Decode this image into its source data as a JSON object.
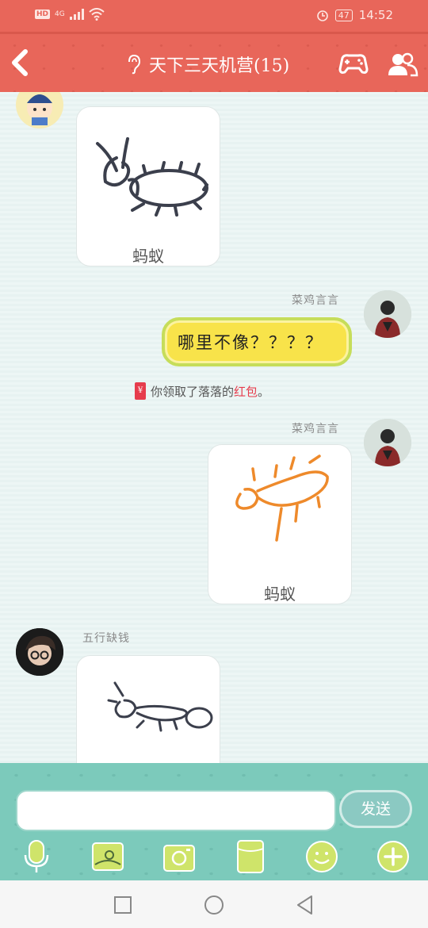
{
  "status_bar": {
    "network": "4G",
    "battery": "47",
    "time": "14:52"
  },
  "header": {
    "title": "天下三天机营(15)"
  },
  "messages": [
    {
      "type": "drawing",
      "sender": "",
      "caption": "蚂蚁",
      "side": "left"
    },
    {
      "type": "text",
      "sender": "菜鸡言言",
      "text": "哪里不像？？？？",
      "side": "right"
    },
    {
      "type": "system",
      "prefix": "你领取了落落的",
      "highlight": "红包",
      "suffix": "。"
    },
    {
      "type": "drawing",
      "sender": "菜鸡言言",
      "caption": "蚂蚁",
      "side": "right"
    },
    {
      "type": "drawing",
      "sender": "五行缺钱",
      "caption": "",
      "side": "left"
    }
  ],
  "input": {
    "placeholder": "",
    "send_label": "发送"
  },
  "toolbar": [
    "microphone-icon",
    "image-icon",
    "camera-icon",
    "file-icon",
    "emoji-icon",
    "add-icon"
  ],
  "colors": {
    "header": "#e8665a",
    "input_area": "#7ccabb",
    "bubble": "#f8e34a",
    "red_packet": "#e63c4c"
  }
}
